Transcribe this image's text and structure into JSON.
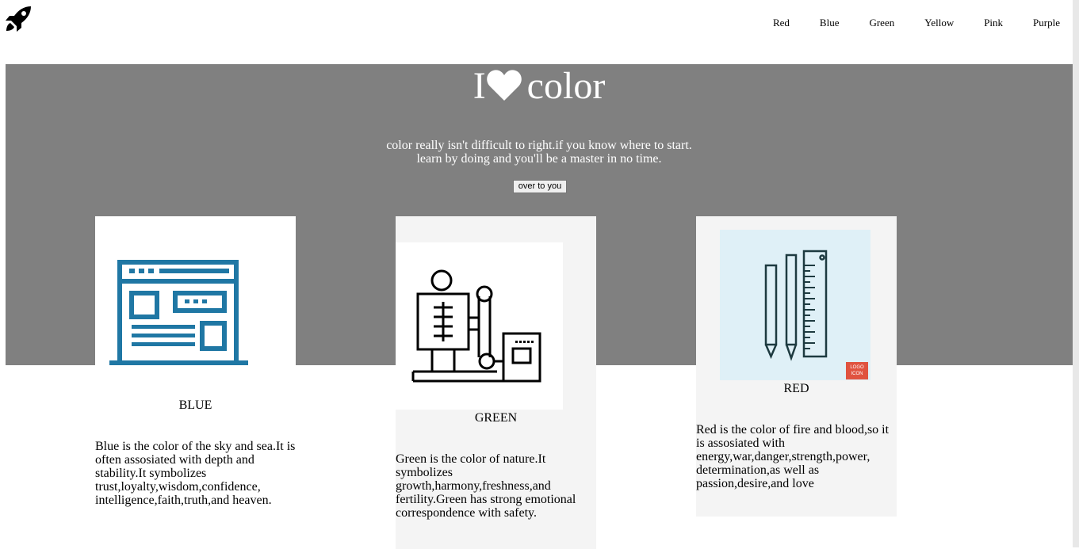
{
  "nav": {
    "items": [
      "Red",
      "Blue",
      "Green",
      "Yellow",
      "Pink",
      "Purple"
    ]
  },
  "hero": {
    "title_prefix": "I",
    "title_word": "color",
    "tagline_line1": "color really isn't difficult to right.if you know where to start.",
    "tagline_line2": "learn by doing and you'll be a master in no time.",
    "cta_label": "over to you"
  },
  "cards": [
    {
      "title": "BLUE",
      "description": "Blue is the color of the sky and sea.It is often assosiated with depth and stability.It symbolizes trust,loyalty,wisdom,confidence, intelligence,faith,truth,and heaven."
    },
    {
      "title": "GREEN",
      "description": "Green is the color of nature.It symbolizes growth,harmony,freshness,and fertility.Green has strong emotional correspondence with safety."
    },
    {
      "title": "RED",
      "description": "Red is the color of fire and blood,so it is assosiated with energy,war,danger,strength,power, determination,as well as passion,desire,and love",
      "badge": "LOGO ICON"
    }
  ],
  "colors": {
    "hero_bg": "#808080",
    "blue_icon": "#1f77a4",
    "red_bg": "#dff0f7",
    "badge": "#e0533f"
  }
}
